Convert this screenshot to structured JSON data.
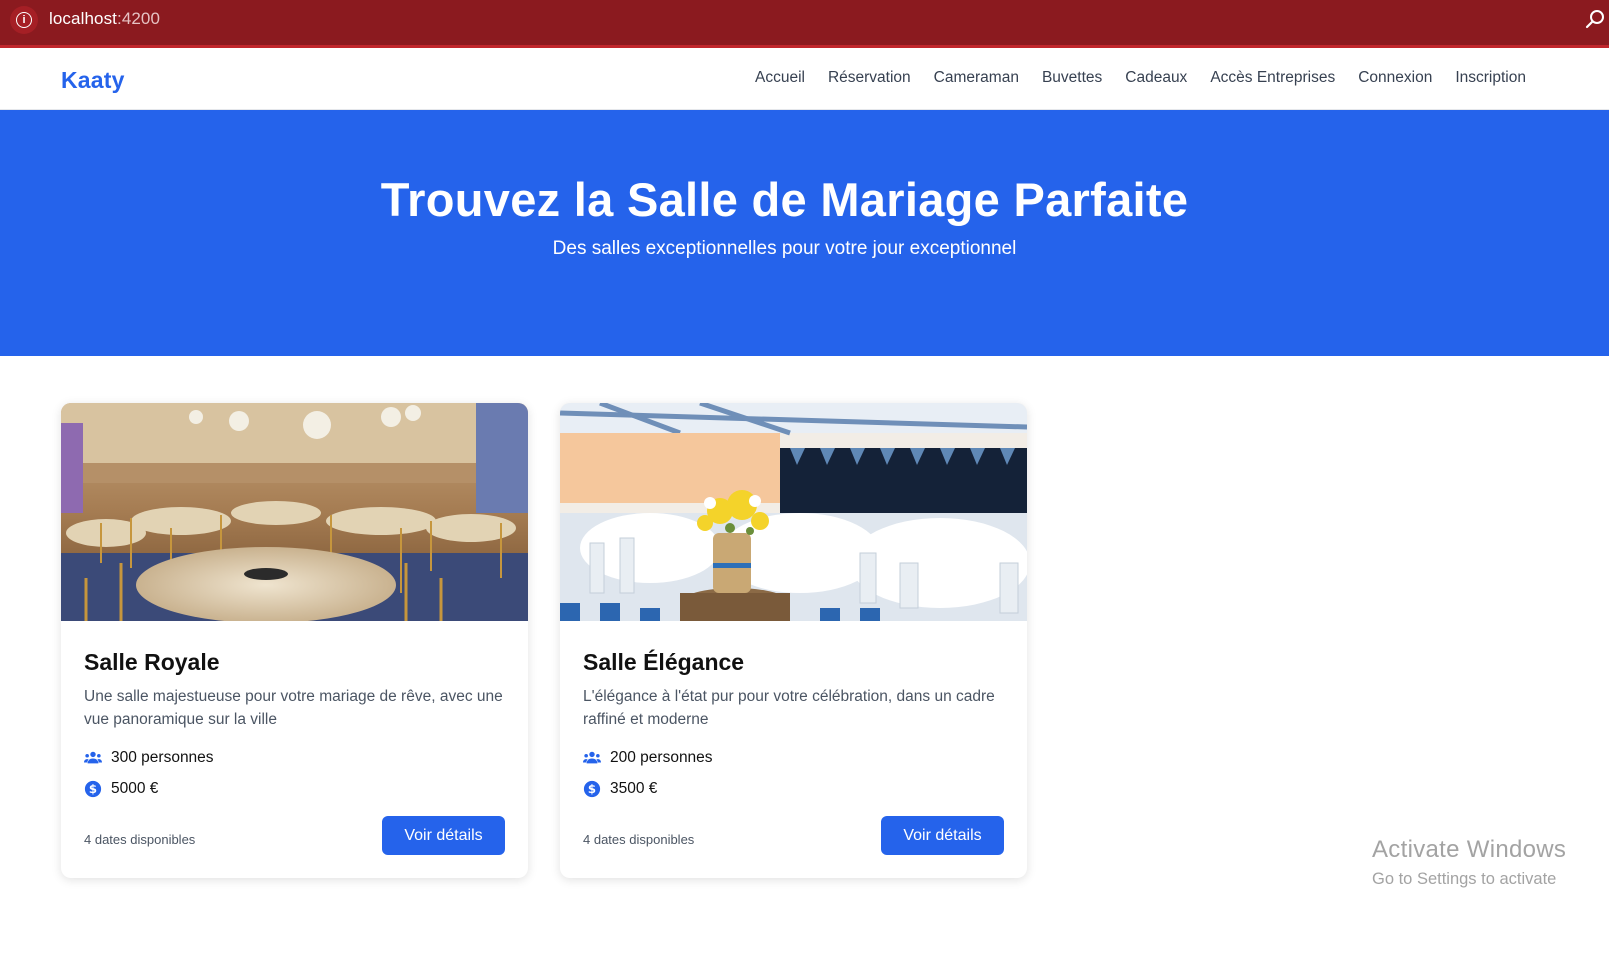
{
  "browser": {
    "url_host": "localhost",
    "url_port": ":4200",
    "info_icon": "info-circle-icon",
    "zoom_icon": "magnifier-icon",
    "colors": {
      "bar": "#8b1a1f"
    }
  },
  "navbar": {
    "brand": "Kaaty",
    "links": [
      "Accueil",
      "Réservation",
      "Cameraman",
      "Buvettes",
      "Cadeaux",
      "Accès Entreprises",
      "Connexion",
      "Inscription"
    ]
  },
  "hero": {
    "title": "Trouvez la Salle de Mariage Parfaite",
    "subtitle": "Des salles exceptionnelles pour votre jour exceptionnel",
    "color": "#2563eb"
  },
  "venues": [
    {
      "image": "banquet-hall-photo",
      "name": "Salle Royale",
      "description": "Une salle majestueuse pour votre mariage de rêve, avec une vue panoramique sur la ville",
      "capacity": "300 personnes",
      "price": "5000 €",
      "availability": "4 dates disponibles",
      "button": "Voir détails"
    },
    {
      "image": "white-table-setting-photo",
      "name": "Salle Élégance",
      "description": "L'élégance à l'état pur pour votre célébration, dans un cadre raffiné et moderne",
      "capacity": "200 personnes",
      "price": "3500 €",
      "availability": "4 dates disponibles",
      "button": "Voir détails"
    }
  ],
  "icons": {
    "capacity": "users-icon",
    "price": "dollar-circle-icon"
  },
  "watermark": {
    "line1": "Activate Windows",
    "line2": "Go to Settings to activate"
  }
}
